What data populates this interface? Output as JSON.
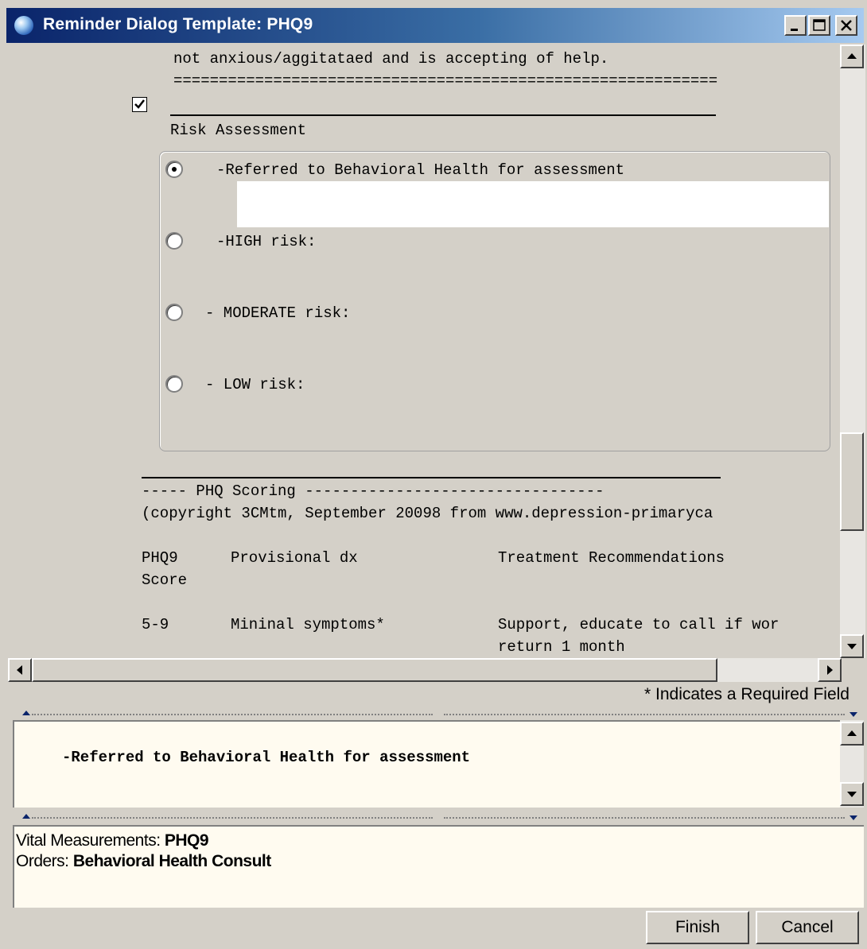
{
  "window": {
    "title": "Reminder Dialog Template: PHQ9",
    "minimize": "_",
    "maximize": "□",
    "close": "×"
  },
  "content": {
    "lines_top": [
      "not anxious/aggitataed and is accepting of help.",
      "============================================================"
    ],
    "risk_section": {
      "checked": true,
      "heading": "Risk Assessment",
      "options": [
        {
          "label": "-Referred to Behavioral Health for assessment",
          "selected": true,
          "field_value": ""
        },
        {
          "label": "-HIGH risk:",
          "selected": false
        },
        {
          "label": "- MODERATE risk:",
          "selected": false
        },
        {
          "label": "- LOW risk:",
          "selected": false
        }
      ]
    },
    "scoring": {
      "header": "----- PHQ Scoring ---------------------------------",
      "copyright": "(copyright 3CMtm, September 20098 from www.depression-primaryca",
      "col1": "PHQ9",
      "col1b": "Score",
      "col2": "Provisional dx",
      "col3": "Treatment Recommendations",
      "row1_score": "5-9",
      "row1_dx": "Mininal symptoms*",
      "row1_tx": "Support, educate to call if wor",
      "row1_tx2": "return 1 month"
    }
  },
  "required_note": "* Indicates a Required Field",
  "preview": {
    "text": "-Referred to Behavioral Health for assessment"
  },
  "summary": {
    "vitals_label": "Vital Measurements:",
    "vitals_value": "PHQ9",
    "orders_label": "Orders:",
    "orders_value": "Behavioral Health Consult"
  },
  "buttons": {
    "finish": "Finish",
    "cancel": "Cancel"
  },
  "colors": {
    "titlebar_start": "#0a246a",
    "titlebar_end": "#a6caf0",
    "panel_bg": "#fffbf0",
    "face": "#d4d0c8"
  }
}
